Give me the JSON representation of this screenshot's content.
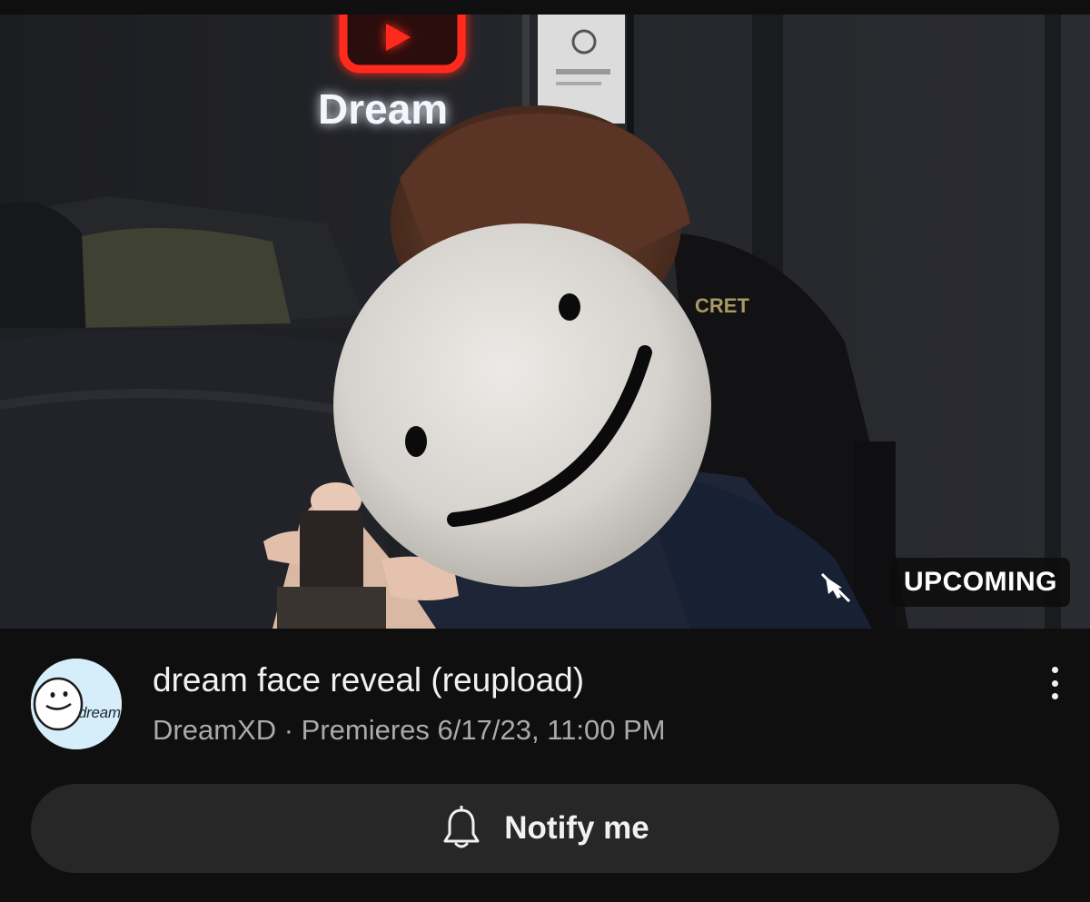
{
  "video": {
    "status_badge": "UPCOMING",
    "title": "dream face reveal (reupload)",
    "channel": "DreamXD",
    "separator": "·",
    "premiere_label": "Premieres 6/17/23, 11:00 PM",
    "sign_text": "Dream",
    "chair_text": "CRET"
  },
  "channel_avatar": {
    "text": "dream",
    "bg_color": "#d6eefa"
  },
  "actions": {
    "notify_label": "Notify me",
    "more_icon": "vertical-ellipsis-icon",
    "notify_icon": "bell-icon",
    "cast_icon": "cast-off-icon"
  },
  "colors": {
    "background": "#0f0f0f",
    "title": "#f1f1f1",
    "secondary_text": "#aaaaaa",
    "button_bg": "#272727",
    "neon_red": "#ff2a1e"
  }
}
